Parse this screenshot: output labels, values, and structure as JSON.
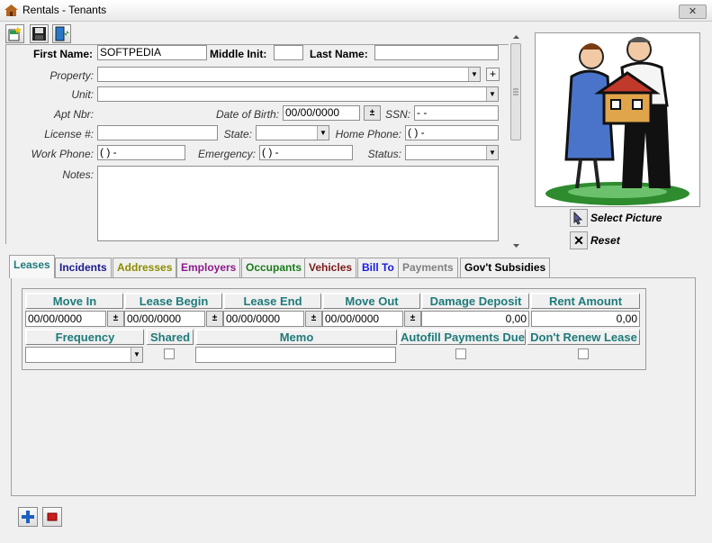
{
  "window": {
    "title": "Rentals - Tenants",
    "close_label": "✕"
  },
  "form": {
    "first_name_label": "First Name:",
    "first_name_value": "SOFTPEDIA",
    "middle_init_label": "Middle Init:",
    "middle_init_value": "",
    "last_name_label": "Last Name:",
    "last_name_value": "",
    "property_label": "Property:",
    "property_value": "",
    "unit_label": "Unit:",
    "unit_value": "",
    "apt_nbr_label": "Apt Nbr:",
    "dob_label": "Date of Birth:",
    "dob_value": "00/00/0000",
    "ssn_label": "SSN:",
    "ssn_value": "  -  -",
    "license_label": "License #:",
    "license_value": "",
    "state_label": "State:",
    "state_value": "",
    "home_phone_label": "Home Phone:",
    "home_phone_value": "(    )     -",
    "work_phone_label": "Work Phone:",
    "work_phone_value": "(    )     -",
    "emergency_label": "Emergency:",
    "emergency_value": "(    )     -",
    "status_label": "Status:",
    "status_value": "",
    "notes_label": "Notes:",
    "notes_value": ""
  },
  "picture": {
    "select_label": "Select Picture",
    "reset_label": "Reset",
    "reset_icon": "✕"
  },
  "tabs": [
    {
      "label": "Leases",
      "color": "#1f7a7a"
    },
    {
      "label": "Incidents",
      "color": "#1a1a8c"
    },
    {
      "label": "Addresses",
      "color": "#8c8c00"
    },
    {
      "label": "Employers",
      "color": "#8c1a8c"
    },
    {
      "label": "Occupants",
      "color": "#1a7a1a"
    },
    {
      "label": "Vehicles",
      "color": "#7a1a1a"
    },
    {
      "label": "Bill To",
      "color": "#1a1ae6"
    },
    {
      "label": "Payments",
      "color": "#808080"
    },
    {
      "label": "Gov't Subsidies",
      "color": "#000000"
    }
  ],
  "leases": {
    "headers": [
      "Move In",
      "Lease Begin",
      "Lease End",
      "Move Out",
      "Damage Deposit",
      "Rent Amount"
    ],
    "row1": [
      "00/00/0000",
      "00/00/0000",
      "00/00/0000",
      "00/00/0000",
      "0,00",
      "0,00"
    ],
    "headers2": [
      "Frequency",
      "Shared",
      "Memo",
      "Autofill Payments Due",
      "Don't Renew Lease"
    ],
    "frequency_value": "",
    "memo_value": ""
  },
  "icons": {
    "spin": "±",
    "dropdown": "▼",
    "plus": "+"
  }
}
